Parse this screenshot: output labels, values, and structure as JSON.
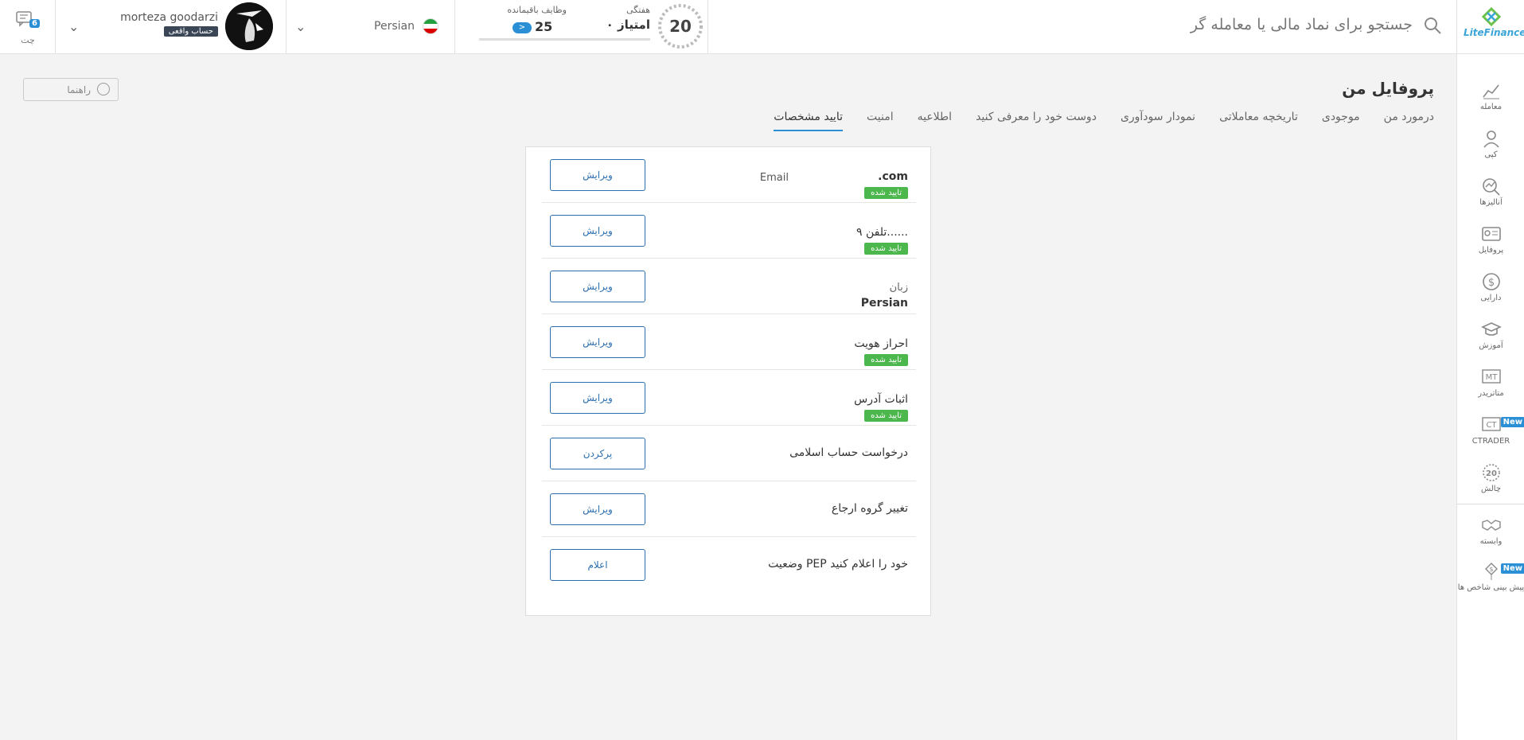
{
  "header": {
    "chat": {
      "label": "چت",
      "count": "6"
    },
    "account": {
      "name": "morteza goodarzi",
      "type": "حساب واقعی"
    },
    "language": {
      "label": "Persian"
    },
    "challenge": {
      "tasks_label": "وظایف باقیمانده",
      "tasks_count": "25",
      "tasks_arrow": ">",
      "week_label": "هفتگی",
      "points": "۰ امتیاز",
      "badge_number": "20"
    },
    "search": {
      "placeholder": "جستجو برای نماد مالی یا معامله گر"
    },
    "logo": {
      "text": "LiteFinance"
    }
  },
  "sidebar": {
    "items": [
      {
        "label": "معامله",
        "icon": "chart-icon"
      },
      {
        "label": "کپی",
        "icon": "copy-user-icon"
      },
      {
        "label": "آنالیزها",
        "icon": "analysis-icon"
      },
      {
        "label": "پروفایل",
        "icon": "profile-card-icon"
      },
      {
        "label": "دارایی",
        "icon": "dollar-icon"
      },
      {
        "label": "آموزش",
        "icon": "graduation-cap-icon"
      },
      {
        "label": "متاتریدر",
        "icon": "mt-icon"
      },
      {
        "label": "CTRADER",
        "icon": "ct-icon",
        "badge": "New"
      },
      {
        "label": "چالش",
        "icon": "challenge-icon"
      },
      {
        "label": "وابسته",
        "icon": "handshake-icon"
      },
      {
        "label": "پیش بینی شاخص ها",
        "icon": "forecast-icon",
        "badge": "New"
      }
    ]
  },
  "main": {
    "guide_label": "راهنما",
    "title": "پروفایل من",
    "tabs": [
      {
        "label": "درمورد من"
      },
      {
        "label": "موجودی"
      },
      {
        "label": "تاریخچه معاملاتی"
      },
      {
        "label": "نمودار سودآوری"
      },
      {
        "label": "دوست خود را معرفی کنید"
      },
      {
        "label": "اطلاعیه"
      },
      {
        "label": "امنیت"
      },
      {
        "label": "تایید مشخصات",
        "active": true
      }
    ],
    "rows": [
      {
        "main": ".com",
        "side_label": "Email",
        "status": "تایید شده",
        "button": "ویرایش"
      },
      {
        "main": "تلفن ۹......",
        "status": "تایید شده",
        "button": "ویرایش"
      },
      {
        "label": "زبان",
        "value": "Persian",
        "button": "ویرایش"
      },
      {
        "main": "احراز هویت",
        "status": "تایید شده",
        "button": "ویرایش"
      },
      {
        "main": "اثبات آدرس",
        "status": "تایید شده",
        "button": "ویرایش"
      },
      {
        "main": "درخواست حساب اسلامی",
        "button": "پرکردن"
      },
      {
        "main": "تغییر گروه ارجاع",
        "button": "ویرایش"
      },
      {
        "main": "وضعیت PEP خود را اعلام کنید",
        "button": "اعلام"
      }
    ]
  },
  "colors": {
    "accent": "#2b8fd6",
    "verified": "#4cb74c",
    "button_border": "#2b6fb0"
  }
}
